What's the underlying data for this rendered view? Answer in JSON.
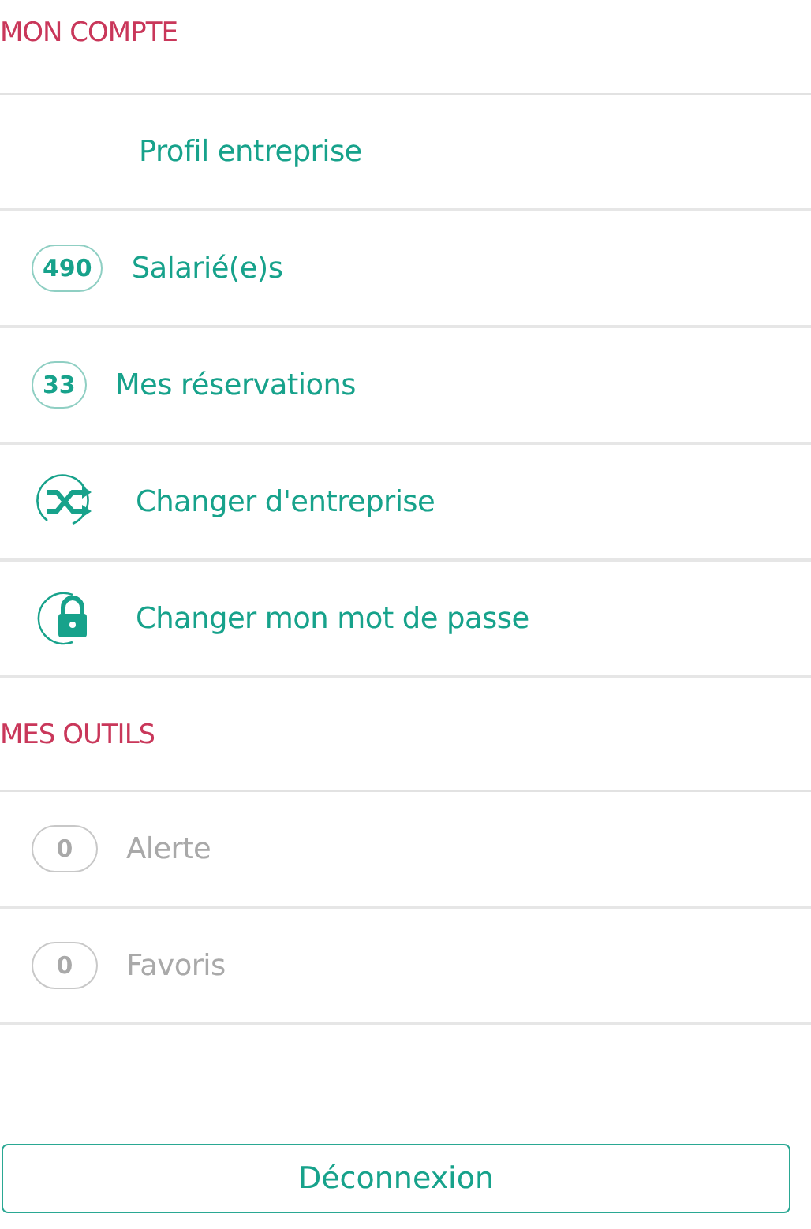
{
  "sections": [
    {
      "title": "MON COMPTE",
      "items": [
        {
          "kind": "plain",
          "label": "Profil entreprise",
          "disabled": false
        },
        {
          "kind": "count",
          "count": "490",
          "label": "Salarié(e)s",
          "disabled": false
        },
        {
          "kind": "count",
          "count": "33",
          "label": "Mes réservations",
          "disabled": false
        },
        {
          "kind": "shuffle",
          "label": "Changer d'entreprise",
          "disabled": false
        },
        {
          "kind": "lock",
          "label": "Changer mon mot de passe",
          "disabled": false
        }
      ]
    },
    {
      "title": "MES OUTILS",
      "items": [
        {
          "kind": "count",
          "count": "0",
          "label": "Alerte",
          "disabled": true
        },
        {
          "kind": "count",
          "count": "0",
          "label": "Favoris",
          "disabled": true
        }
      ]
    }
  ],
  "logout": "Déconnexion"
}
